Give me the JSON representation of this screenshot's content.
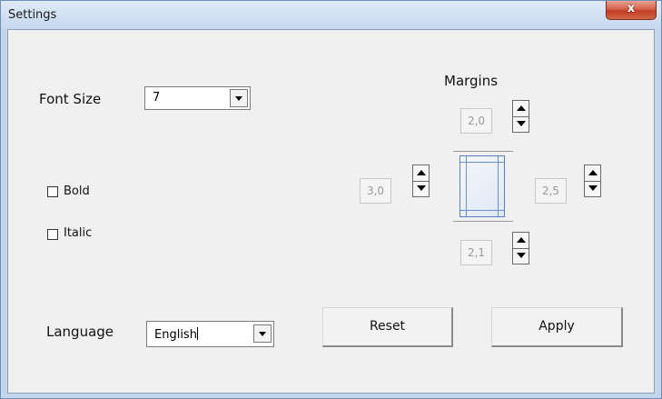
{
  "window": {
    "title": "Settings",
    "close_glyph": "x"
  },
  "font_size": {
    "label": "Font Size",
    "value": "7"
  },
  "bold": {
    "label": "Bold",
    "checked": false
  },
  "italic": {
    "label": "Italic",
    "checked": false
  },
  "language": {
    "label": "Language",
    "value": "English"
  },
  "margins": {
    "label": "Margins",
    "top": "2,0",
    "left": "3,0",
    "right": "2,5",
    "bottom": "2,1"
  },
  "buttons": {
    "reset": "Reset",
    "apply": "Apply"
  },
  "icons": {
    "close": "close-icon",
    "dropdown": "chevron-down-icon",
    "spin_up": "spin-up-icon",
    "spin_down": "spin-down-icon",
    "page": "page-preview-icon"
  },
  "colors": {
    "titlebar": "#c6d8ee",
    "close_button": "#c23c24",
    "client_background": "#f0f0f0",
    "page_margin_lines": "#6d8fcb"
  }
}
